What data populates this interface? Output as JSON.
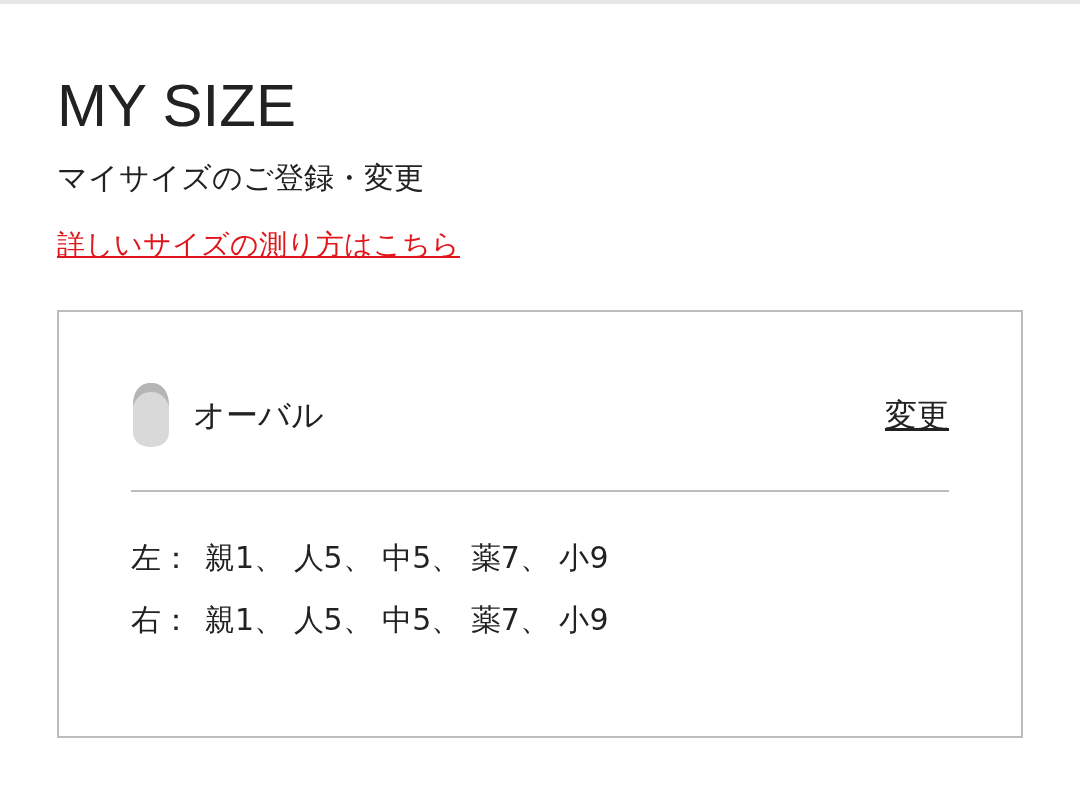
{
  "title": "MY SIZE",
  "subtitle": "マイサイズのご登録・変更",
  "guide_link": "詳しいサイズの測り方はこちら",
  "card": {
    "shape": "オーバル",
    "change_link": "変更",
    "rows": [
      {
        "side": "左：",
        "sizes": "親1、 人5、 中5、 薬7、 小9"
      },
      {
        "side": "右：",
        "sizes": "親1、 人5、 中5、 薬7、 小9"
      }
    ]
  }
}
